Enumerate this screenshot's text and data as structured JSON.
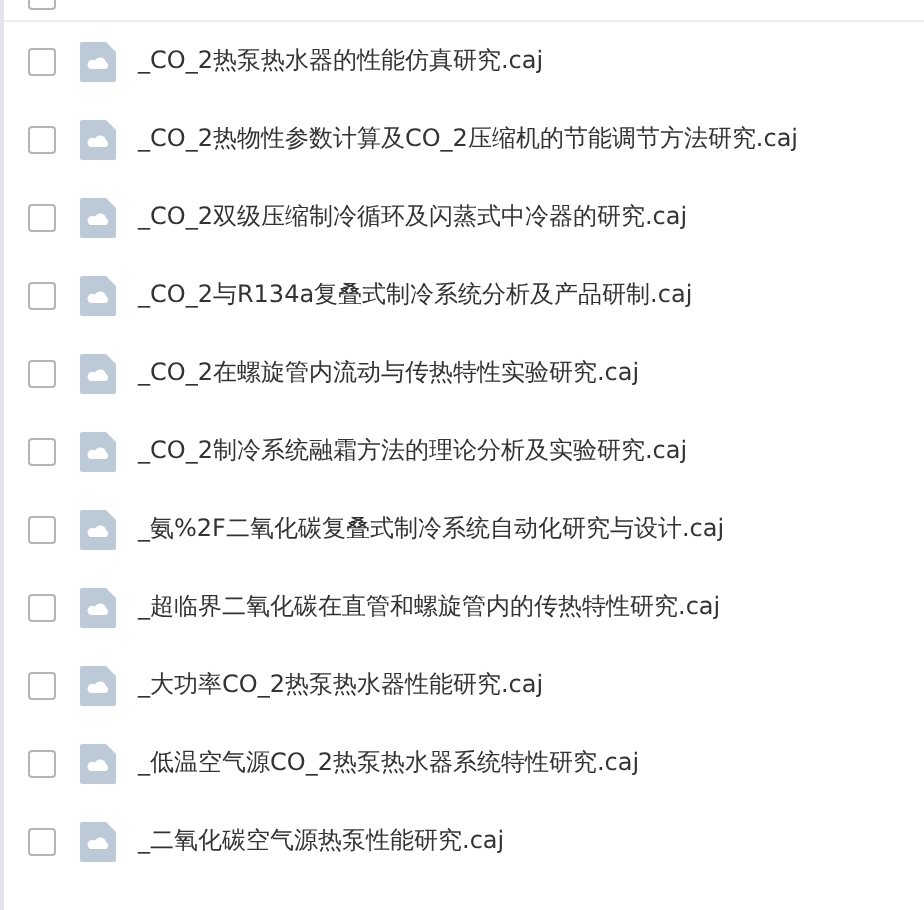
{
  "header": {
    "checked": false
  },
  "files": [
    {
      "name": "_CO_2热泵热水器的性能仿真研究.caj",
      "checked": false
    },
    {
      "name": "_CO_2热物性参数计算及CO_2压缩机的节能调节方法研究.caj",
      "checked": false
    },
    {
      "name": "_CO_2双级压缩制冷循环及闪蒸式中冷器的研究.caj",
      "checked": false
    },
    {
      "name": "_CO_2与R134a复叠式制冷系统分析及产品研制.caj",
      "checked": false
    },
    {
      "name": "_CO_2在螺旋管内流动与传热特性实验研究.caj",
      "checked": false
    },
    {
      "name": "_CO_2制冷系统融霜方法的理论分析及实验研究.caj",
      "checked": false
    },
    {
      "name": "_氨%2F二氧化碳复叠式制冷系统自动化研究与设计.caj",
      "checked": false
    },
    {
      "name": "_超临界二氧化碳在直管和螺旋管内的传热特性研究.caj",
      "checked": false
    },
    {
      "name": "_大功率CO_2热泵热水器性能研究.caj",
      "checked": false
    },
    {
      "name": "_低温空气源CO_2热泵热水器系统特性研究.caj",
      "checked": false
    },
    {
      "name": "_二氧化碳空气源热泵性能研究.caj",
      "checked": false
    }
  ]
}
